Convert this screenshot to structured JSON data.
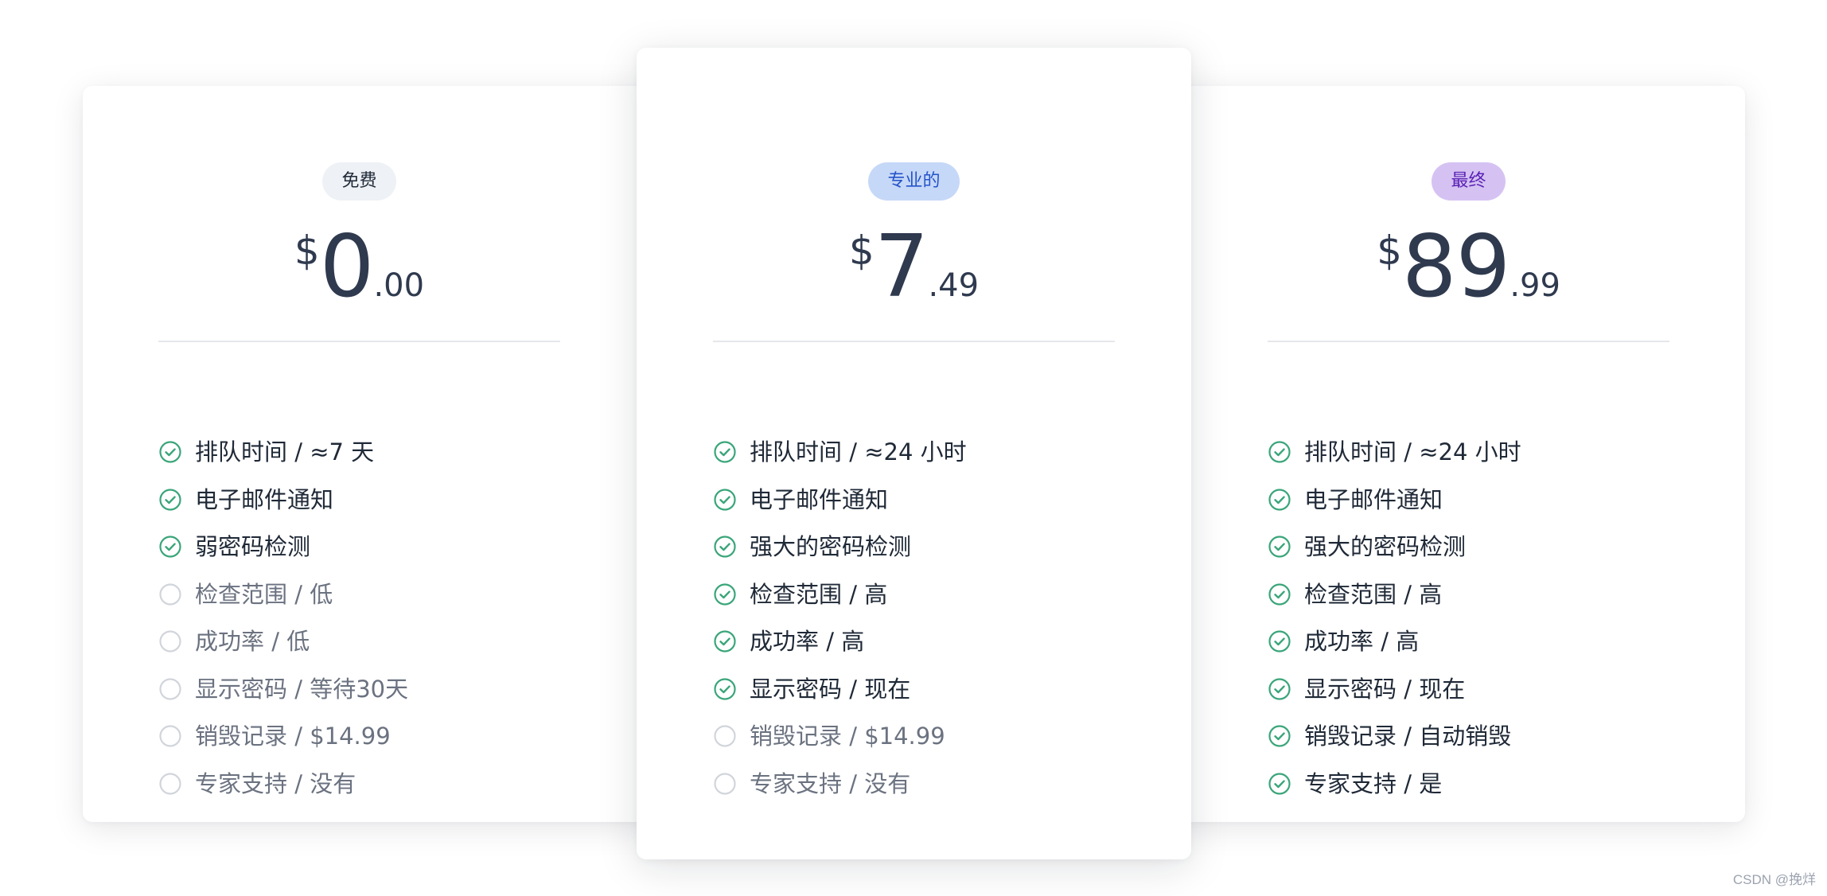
{
  "plans": [
    {
      "badge": "免费",
      "price": {
        "currency": "$",
        "integer": "0",
        "cents": ".00"
      },
      "features": [
        {
          "text": "排队时间 / ≈7 天",
          "included": true
        },
        {
          "text": "电子邮件通知",
          "included": true
        },
        {
          "text": "弱密码检测",
          "included": true
        },
        {
          "text": "检查范围 / 低",
          "included": false
        },
        {
          "text": "成功率 / 低",
          "included": false
        },
        {
          "text": "显示密码 / 等待30天",
          "included": false
        },
        {
          "text": "销毁记录 / $14.99",
          "included": false
        },
        {
          "text": "专家支持 / 没有",
          "included": false
        }
      ]
    },
    {
      "badge": "专业的",
      "price": {
        "currency": "$",
        "integer": "7",
        "cents": ".49"
      },
      "features": [
        {
          "text": "排队时间 / ≈24 小时",
          "included": true
        },
        {
          "text": "电子邮件通知",
          "included": true
        },
        {
          "text": "强大的密码检测",
          "included": true
        },
        {
          "text": "检查范围 / 高",
          "included": true
        },
        {
          "text": "成功率 / 高",
          "included": true
        },
        {
          "text": "显示密码 / 现在",
          "included": true
        },
        {
          "text": "销毁记录 / $14.99",
          "included": false
        },
        {
          "text": "专家支持 / 没有",
          "included": false
        }
      ]
    },
    {
      "badge": "最终",
      "price": {
        "currency": "$",
        "integer": "89",
        "cents": ".99"
      },
      "features": [
        {
          "text": "排队时间 / ≈24 小时",
          "included": true
        },
        {
          "text": "电子邮件通知",
          "included": true
        },
        {
          "text": "强大的密码检测",
          "included": true
        },
        {
          "text": "检查范围 / 高",
          "included": true
        },
        {
          "text": "成功率 / 高",
          "included": true
        },
        {
          "text": "显示密码 / 现在",
          "included": true
        },
        {
          "text": "销毁记录 / 自动销毁",
          "included": true
        },
        {
          "text": "专家支持 / 是",
          "included": true
        }
      ]
    }
  ],
  "watermark": "CSDN @挽烊",
  "colors": {
    "check": "#3aa57a",
    "circle_off": "#d1d5db",
    "price_text": "#2f3a4f"
  },
  "icons": {
    "included": "check-circle-icon",
    "excluded": "empty-circle-icon"
  }
}
